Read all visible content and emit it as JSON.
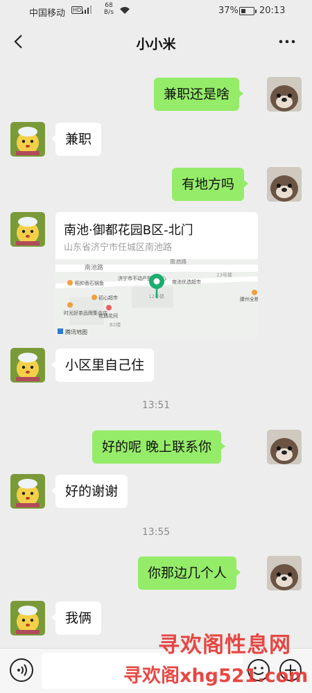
{
  "status_bar": {
    "carrier": "中国移动",
    "hd": "HD",
    "speed_value": "68",
    "speed_unit": "B/s",
    "battery": "37%",
    "time": "20:13"
  },
  "nav": {
    "title": "小小米"
  },
  "messages": [
    {
      "side": "out",
      "text": "兼职还是啥"
    },
    {
      "side": "in",
      "text": "兼职"
    },
    {
      "side": "out",
      "text": "有地方吗"
    },
    {
      "side": "in",
      "type": "location"
    },
    {
      "side": "in",
      "text": "小区里自己住"
    },
    {
      "type": "time",
      "text": "13:51"
    },
    {
      "side": "out",
      "text": "好的呢  晚上联系你"
    },
    {
      "side": "in",
      "text": "好的谢谢"
    },
    {
      "type": "time",
      "text": "13:55"
    },
    {
      "side": "out",
      "text": "你那边几个人"
    },
    {
      "side": "in",
      "text": "我俩"
    }
  ],
  "location": {
    "name": "南池·御都花园B区-北门",
    "address": "山东省济宁市任城区南池路",
    "map_labels": {
      "road_top": "南池路",
      "road_top2": "南池路",
      "building_13": "13号楼",
      "poi_fish": "稻抑香石锅鱼",
      "poi_gov": "济宁市不动产登记中心",
      "poi_market": "南池优选超市",
      "poi_chuxin": "初心超市",
      "poi_tea": "时光好茶品牌集合店",
      "poi_flower": "花遇花间",
      "poi_teng": "滕州全粮",
      "building_12": "12号楼",
      "building_b2": "B2楼",
      "provider": "腾讯地图"
    }
  },
  "watermark": {
    "line1": "寻欢阁性息网",
    "line2": "寻欢阁xhg521.com"
  },
  "colors": {
    "out_bubble": "#95ec69",
    "in_bubble": "#ffffff",
    "background": "#ededed",
    "pin": "#1aad6e"
  }
}
